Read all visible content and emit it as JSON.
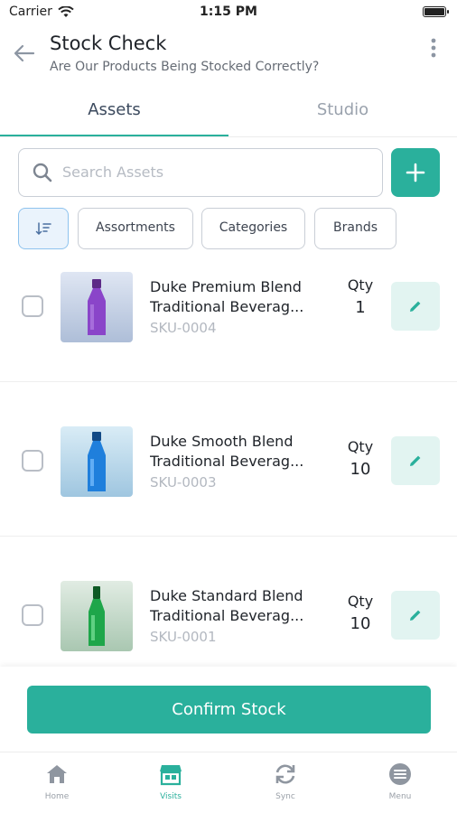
{
  "status_bar": {
    "carrier": "Carrier",
    "time": "1:15 PM"
  },
  "header": {
    "title": "Stock Check",
    "subtitle": "Are Our Products Being Stocked Correctly?"
  },
  "tabs": [
    {
      "label": "Assets",
      "active": true
    },
    {
      "label": "Studio",
      "active": false
    }
  ],
  "search": {
    "placeholder": "Search Assets",
    "value": ""
  },
  "filters": {
    "chips": [
      "Assortments",
      "Categories",
      "Brands"
    ]
  },
  "products": [
    {
      "name_line1": "Duke Premium Blend",
      "name_line2": "Traditional Beverag...",
      "sku": "SKU-0004",
      "qty_label": "Qty",
      "qty": "1",
      "bottle_color": "#8a45c9"
    },
    {
      "name_line1": "Duke Smooth Blend",
      "name_line2": "Traditional Beverag...",
      "sku": "SKU-0003",
      "qty_label": "Qty",
      "qty": "10",
      "bottle_color": "#1f7fdc"
    },
    {
      "name_line1": "Duke Standard Blend",
      "name_line2": "Traditional Beverag...",
      "sku": "SKU-0001",
      "qty_label": "Qty",
      "qty": "10",
      "bottle_color": "#1ea64a"
    }
  ],
  "confirm_button": "Confirm Stock",
  "bottom_nav": [
    {
      "label": "Home",
      "icon": "home-icon",
      "active": false
    },
    {
      "label": "Visits",
      "icon": "store-icon",
      "active": true
    },
    {
      "label": "Sync",
      "icon": "sync-icon",
      "active": false
    },
    {
      "label": "Menu",
      "icon": "menu-icon",
      "active": false
    }
  ],
  "colors": {
    "accent": "#2ab09c",
    "accent_light": "#e2f4f1",
    "sort_chip_bg": "#eaf3fc",
    "text_muted": "#b3b8c0"
  }
}
